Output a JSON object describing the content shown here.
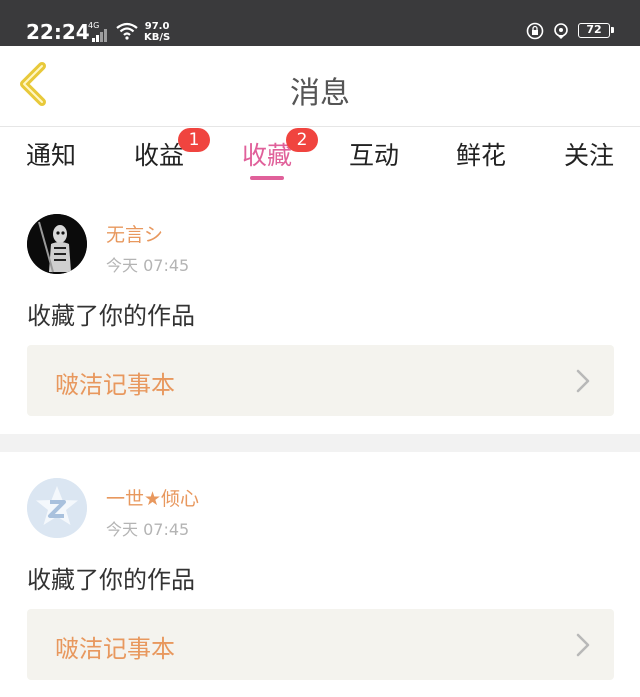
{
  "status_bar": {
    "time": "22:24",
    "network": "4G",
    "speed_value": "97.0",
    "speed_unit": "KB/S",
    "battery": "72"
  },
  "header": {
    "title": "消息"
  },
  "tabs": [
    {
      "label": "通知",
      "badge": ""
    },
    {
      "label": "收益",
      "badge": "1"
    },
    {
      "label": "收藏",
      "badge": "2",
      "active": true
    },
    {
      "label": "互动",
      "badge": ""
    },
    {
      "label": "鲜花",
      "badge": ""
    },
    {
      "label": "关注",
      "badge": ""
    }
  ],
  "messages": [
    {
      "username": "无言シ",
      "time": "今天 07:45",
      "action": "收藏了你的作品",
      "work_title": "啵洁记事本"
    },
    {
      "username": "一世★倾心",
      "time": "今天 07:45",
      "action": "收藏了你的作品",
      "work_title": "啵洁记事本"
    }
  ],
  "colors": {
    "accent": "#e0609a",
    "username": "#e8985e",
    "badge": "#f0443f",
    "back_icon": "#e8c93a"
  }
}
